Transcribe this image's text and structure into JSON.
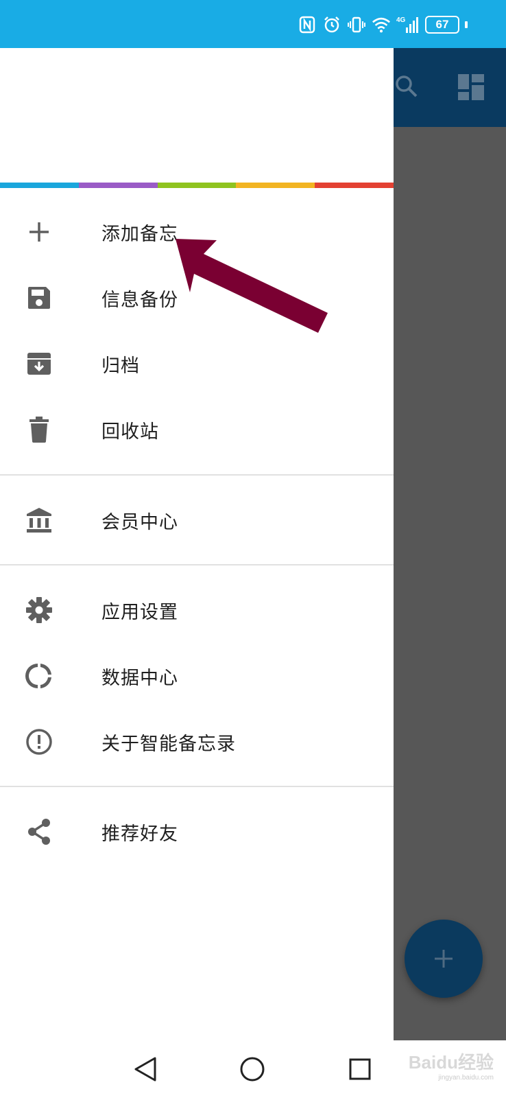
{
  "status_bar": {
    "battery_level": "67",
    "network": "4G"
  },
  "drawer": {
    "rainbow_colors": [
      "#1aa6dc",
      "#9a5bc6",
      "#8fc31f",
      "#f2b422",
      "#e34132"
    ],
    "groups": [
      [
        {
          "id": "add-note",
          "label": "添加备忘",
          "icon": "plus-icon"
        },
        {
          "id": "backup",
          "label": "信息备份",
          "icon": "floppy-disk-icon"
        },
        {
          "id": "archive",
          "label": "归档",
          "icon": "archive-box-icon"
        },
        {
          "id": "trash",
          "label": "回收站",
          "icon": "trash-can-icon"
        }
      ],
      [
        {
          "id": "membership",
          "label": "会员中心",
          "icon": "bank-icon"
        }
      ],
      [
        {
          "id": "settings",
          "label": "应用设置",
          "icon": "gear-icon"
        },
        {
          "id": "data-center",
          "label": "数据中心",
          "icon": "donut-chart-icon"
        },
        {
          "id": "about",
          "label": "关于智能备忘录",
          "icon": "info-alert-icon"
        }
      ],
      [
        {
          "id": "share",
          "label": "推荐好友",
          "icon": "share-icon"
        }
      ]
    ]
  },
  "annotation": {
    "color": "#7a0032",
    "target": "添加备忘"
  },
  "watermark": {
    "brand": "Baidu经验",
    "url": "jingyan.baidu.com"
  },
  "colors": {
    "status_bar": "#19ace5",
    "toolbar": "#0a3a60",
    "fab": "#0b3a5e",
    "scrim": "#575757"
  }
}
